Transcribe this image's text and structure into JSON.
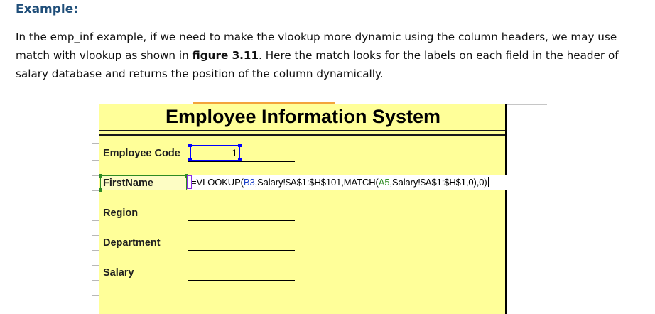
{
  "document": {
    "heading": "Example:",
    "para_before": "In the emp_inf example, if we need to make the vlookup more dynamic using the column headers, we may use match with vlookup as shown in ",
    "para_bold": "figure 3.11",
    "para_after": ". Here the match looks for the labels on each field in the header of salary database and returns the position of the column dynamically."
  },
  "sheet": {
    "title": "Employee Information System",
    "fields": {
      "employee_code": "Employee Code",
      "first_name": "FirstName",
      "region": "Region",
      "department": "Department",
      "salary": "Salary"
    },
    "employee_code_value": "1",
    "formula": {
      "p1": "=VLOOKUP(",
      "ref1": "B3",
      "p2": ",Salary!$A$1:$H$101,MATCH(",
      "ref2": "A5",
      "p3": ",Salary!$A$1:$H$1,0),0)"
    }
  },
  "colors": {
    "heading": "#1f4e79",
    "sheet_fill": "#ffff99",
    "ref_blue": "#1a3fc9",
    "ref_green": "#2e8b23",
    "column_select": "#f3a43b"
  }
}
